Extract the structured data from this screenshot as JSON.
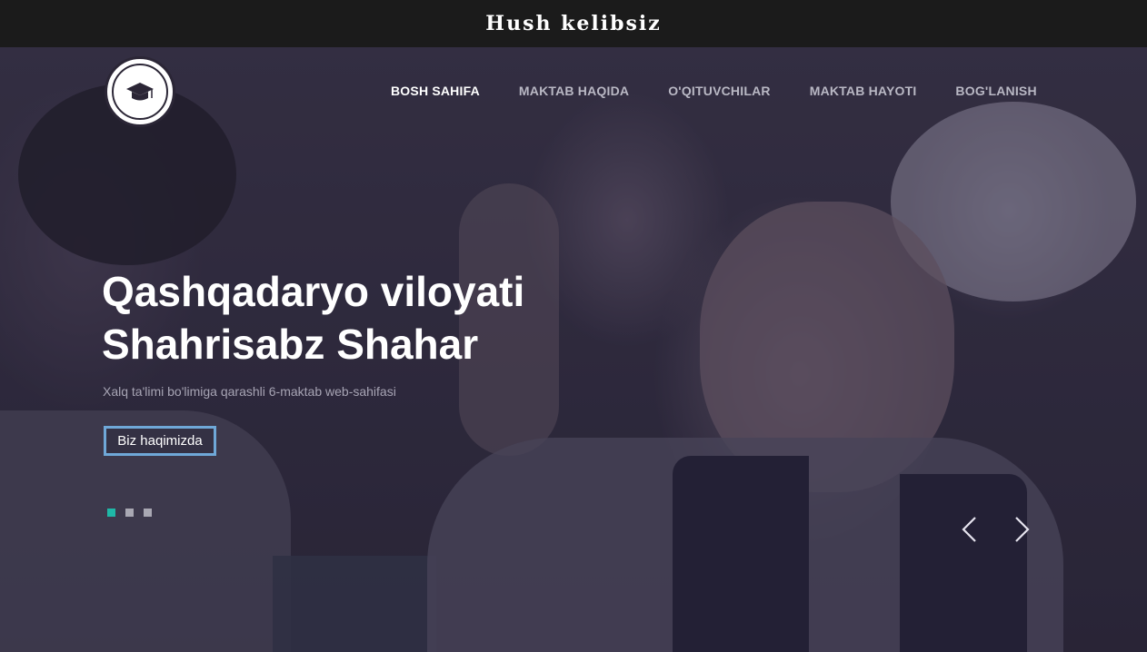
{
  "topbar": {
    "title": "Hush kelibsiz"
  },
  "logo": {
    "icon": "school-logo-icon"
  },
  "nav": {
    "items": [
      {
        "label": "BOSH SAHIFA",
        "active": true
      },
      {
        "label": "MAKTAB HAQIDA",
        "active": false
      },
      {
        "label": "O'QITUVCHILAR",
        "active": false
      },
      {
        "label": "MAKTAB HAYOTI",
        "active": false
      },
      {
        "label": "BOG'LANISH",
        "active": false
      }
    ]
  },
  "hero": {
    "title_line1": "Qashqadaryo viloyati",
    "title_line2": "Shahrisabz Shahar",
    "subtitle": "Xalq ta'limi bo'limiga qarashli 6-maktab web-sahifasi",
    "button_label": "Biz haqimizda",
    "slides": 3,
    "active_slide": 1
  },
  "colors": {
    "accent": "#6fa8d8",
    "active_dot": "#1fb8a7",
    "topbar_bg": "#1b1b1b"
  }
}
